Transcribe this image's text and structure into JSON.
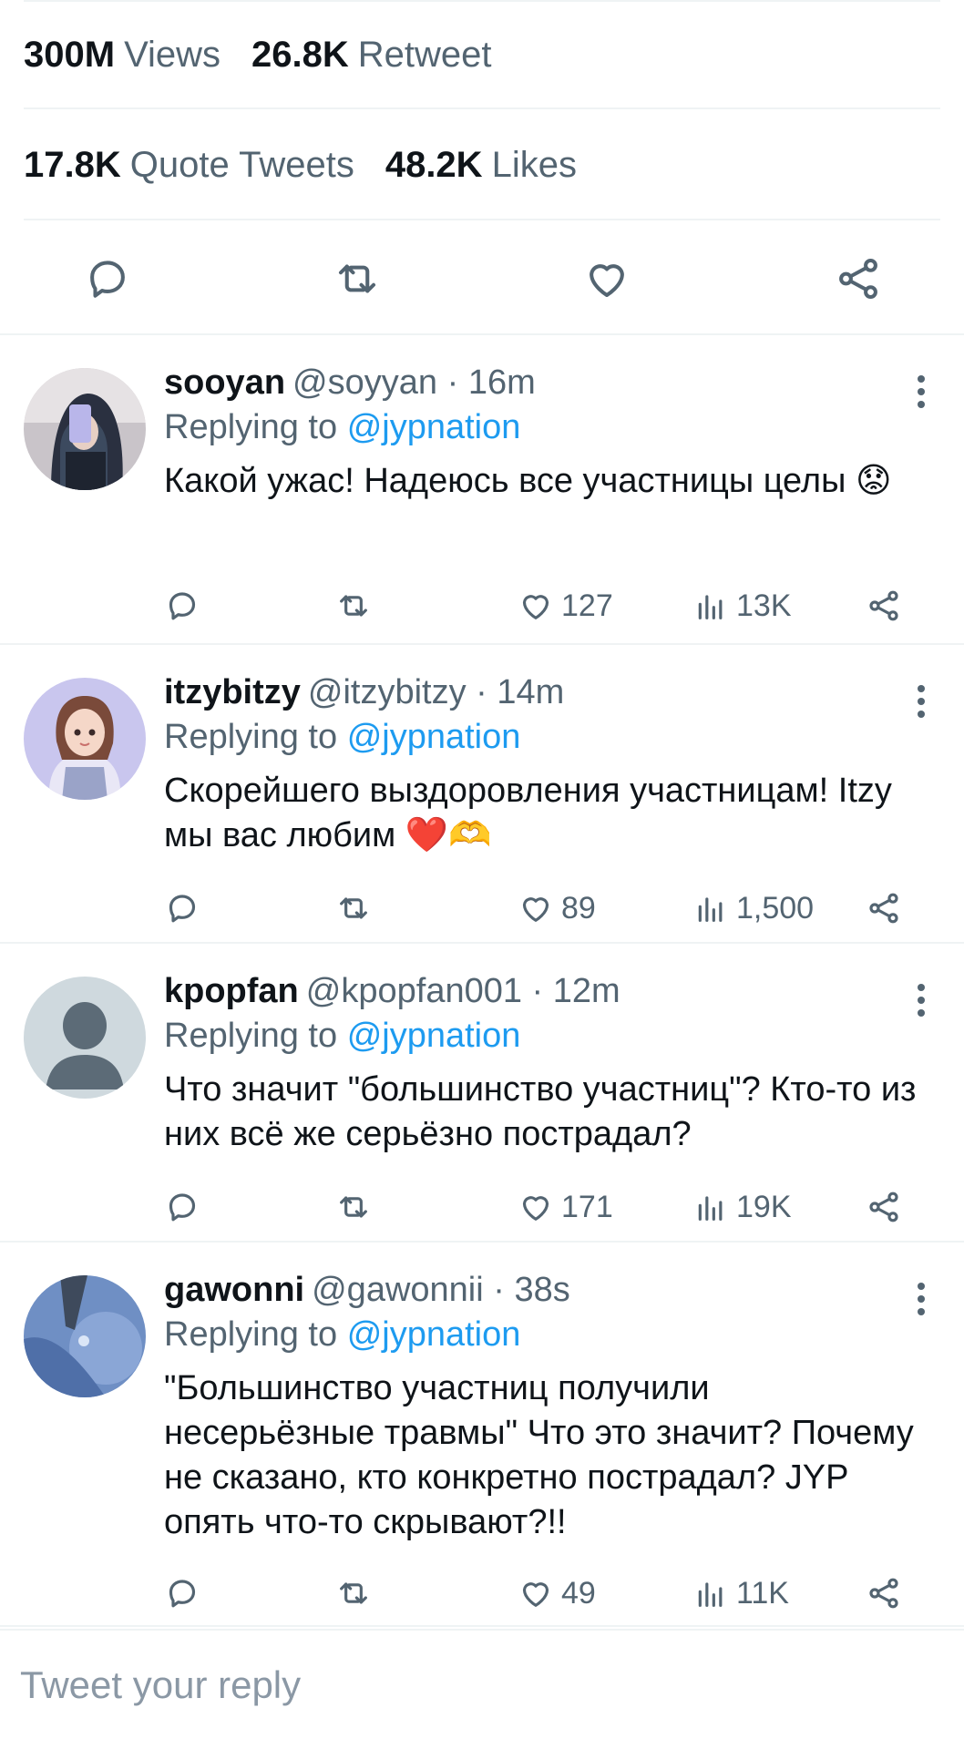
{
  "stats": {
    "views_count": "300M",
    "views_label": "Views",
    "retweets_count": "26.8K",
    "retweets_label": "Retweet",
    "quotes_count": "17.8K",
    "quotes_label": "Quote Tweets",
    "likes_count": "48.2K",
    "likes_label": "Likes"
  },
  "colors": {
    "link": "#1d9bf0",
    "secondary_text": "#536471",
    "divider": "#eff3f4"
  },
  "replies": [
    {
      "name": "sooyan",
      "handle": "@soyyan",
      "time": "16m",
      "replying_label": "Replying to",
      "replying_to": "@jypnation",
      "text": "Какой ужас! Надеюсь все участницы целы 😟",
      "likes": "127",
      "views": "13K"
    },
    {
      "name": "itzybitzy",
      "handle": "@itzybitzy",
      "time": "14m",
      "replying_label": "Replying to",
      "replying_to": "@jypnation",
      "text": "Скорейшего выздоровления участницам! Itzy мы вас любим ❤️🫶",
      "likes": "89",
      "views": "1,500"
    },
    {
      "name": "kpopfan",
      "handle": "@kpopfan001",
      "time": "12m",
      "replying_label": "Replying to",
      "replying_to": "@jypnation",
      "text": "Что значит \"большинство участниц\"? Кто-то из них всё же серьёзно пострадал?",
      "likes": "171",
      "views": "19K"
    },
    {
      "name": "gawonni",
      "handle": "@gawonnii",
      "time": "38s",
      "replying_label": "Replying to",
      "replying_to": "@jypnation",
      "text": "\"Большинство участниц получили несерьёзные травмы\" Что это значит? Почему не сказано, кто конкретно пострадал? JYP опять что-то скрывают?!!",
      "likes": "49",
      "views": "11K"
    }
  ],
  "composer": {
    "placeholder": "Tweet your reply"
  }
}
